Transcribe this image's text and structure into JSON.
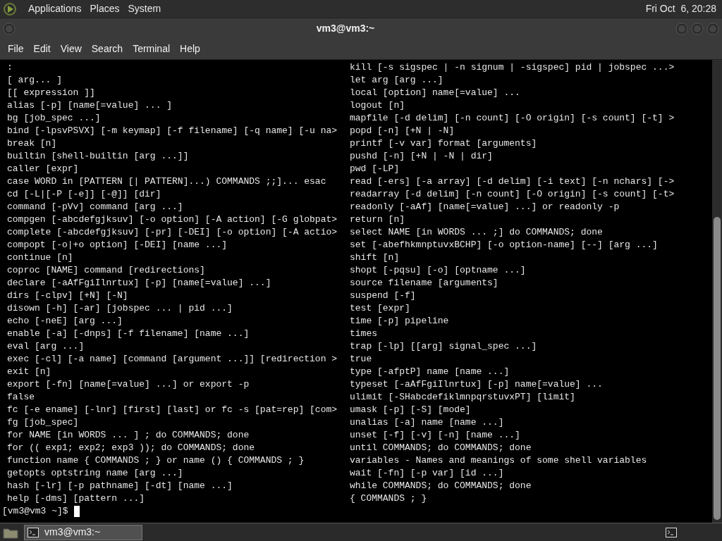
{
  "top_panel": {
    "menus": [
      "Applications",
      "Places",
      "System"
    ],
    "clock": "Fri Oct  6, 20:28"
  },
  "window": {
    "title": "vm3@vm3:~",
    "menu": [
      "File",
      "Edit",
      "View",
      "Search",
      "Terminal",
      "Help"
    ]
  },
  "terminal": {
    "left_column": [
      ":",
      "[ arg... ]",
      "[[ expression ]]",
      "alias [-p] [name[=value] ... ]",
      "bg [job_spec ...]",
      "bind [-lpsvPSVX] [-m keymap] [-f filename] [-q name] [-u na>",
      "break [n]",
      "builtin [shell-builtin [arg ...]]",
      "caller [expr]",
      "case WORD in [PATTERN [| PATTERN]...) COMMANDS ;;]... esac",
      "cd [-L|[-P [-e]] [-@]] [dir]",
      "command [-pVv] command [arg ...]",
      "compgen [-abcdefgjksuv] [-o option] [-A action] [-G globpat>",
      "complete [-abcdefgjksuv] [-pr] [-DEI] [-o option] [-A actio>",
      "compopt [-o|+o option] [-DEI] [name ...]",
      "continue [n]",
      "coproc [NAME] command [redirections]",
      "declare [-aAfFgiIlnrtux] [-p] [name[=value] ...]",
      "dirs [-clpv] [+N] [-N]",
      "disown [-h] [-ar] [jobspec ... | pid ...]",
      "echo [-neE] [arg ...]",
      "enable [-a] [-dnps] [-f filename] [name ...]",
      "eval [arg ...]",
      "exec [-cl] [-a name] [command [argument ...]] [redirection >",
      "exit [n]",
      "export [-fn] [name[=value] ...] or export -p",
      "false",
      "fc [-e ename] [-lnr] [first] [last] or fc -s [pat=rep] [com>",
      "fg [job_spec]",
      "for NAME [in WORDS ... ] ; do COMMANDS; done",
      "for (( exp1; exp2; exp3 )); do COMMANDS; done",
      "function name { COMMANDS ; } or name () { COMMANDS ; }",
      "getopts optstring name [arg ...]",
      "hash [-lr] [-p pathname] [-dt] [name ...]",
      "help [-dms] [pattern ...]"
    ],
    "right_column": [
      "kill [-s sigspec | -n signum | -sigspec] pid | jobspec ...>",
      "let arg [arg ...]",
      "local [option] name[=value] ...",
      "logout [n]",
      "mapfile [-d delim] [-n count] [-O origin] [-s count] [-t] >",
      "popd [-n] [+N | -N]",
      "printf [-v var] format [arguments]",
      "pushd [-n] [+N | -N | dir]",
      "pwd [-LP]",
      "read [-ers] [-a array] [-d delim] [-i text] [-n nchars] [->",
      "readarray [-d delim] [-n count] [-O origin] [-s count] [-t>",
      "readonly [-aAf] [name[=value] ...] or readonly -p",
      "return [n]",
      "select NAME [in WORDS ... ;] do COMMANDS; done",
      "set [-abefhkmnptuvxBCHP] [-o option-name] [--] [arg ...]",
      "shift [n]",
      "shopt [-pqsu] [-o] [optname ...]",
      "source filename [arguments]",
      "suspend [-f]",
      "test [expr]",
      "time [-p] pipeline",
      "times",
      "trap [-lp] [[arg] signal_spec ...]",
      "true",
      "type [-afptP] name [name ...]",
      "typeset [-aAfFgiIlnrtux] [-p] name[=value] ...",
      "ulimit [-SHabcdefiklmnpqrstuvxPT] [limit]",
      "umask [-p] [-S] [mode]",
      "unalias [-a] name [name ...]",
      "unset [-f] [-v] [-n] [name ...]",
      "until COMMANDS; do COMMANDS; done",
      "variables - Names and meanings of some shell variables",
      "wait [-fn] [-p var] [id ...]",
      "while COMMANDS; do COMMANDS; done",
      "{ COMMANDS ; }"
    ],
    "prompt": "[vm3@vm3 ~]$"
  },
  "taskbar": {
    "tasks": [
      {
        "label": "vm3@vm3:~",
        "selected": true
      }
    ]
  }
}
